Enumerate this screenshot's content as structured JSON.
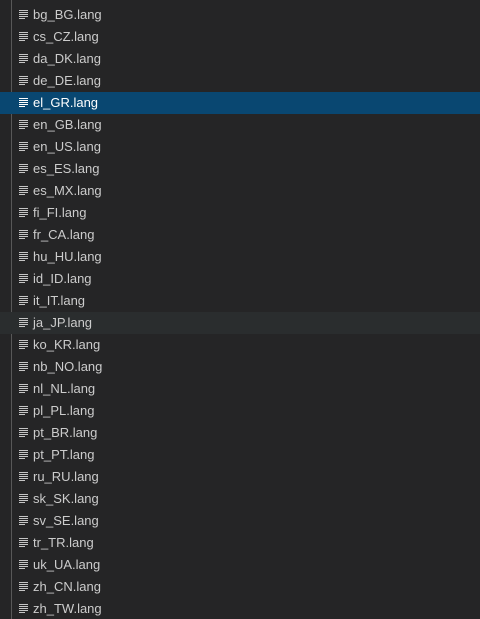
{
  "explorer": {
    "files": [
      {
        "name": "bg_BG.lang",
        "icon": "file-text-icon"
      },
      {
        "name": "cs_CZ.lang",
        "icon": "file-text-icon"
      },
      {
        "name": "da_DK.lang",
        "icon": "file-text-icon"
      },
      {
        "name": "de_DE.lang",
        "icon": "file-text-icon"
      },
      {
        "name": "el_GR.lang",
        "icon": "file-text-icon"
      },
      {
        "name": "en_GB.lang",
        "icon": "file-text-icon"
      },
      {
        "name": "en_US.lang",
        "icon": "file-text-icon"
      },
      {
        "name": "es_ES.lang",
        "icon": "file-text-icon"
      },
      {
        "name": "es_MX.lang",
        "icon": "file-text-icon"
      },
      {
        "name": "fi_FI.lang",
        "icon": "file-text-icon"
      },
      {
        "name": "fr_CA.lang",
        "icon": "file-text-icon"
      },
      {
        "name": "hu_HU.lang",
        "icon": "file-text-icon"
      },
      {
        "name": "id_ID.lang",
        "icon": "file-text-icon"
      },
      {
        "name": "it_IT.lang",
        "icon": "file-text-icon"
      },
      {
        "name": "ja_JP.lang",
        "icon": "file-text-icon"
      },
      {
        "name": "ko_KR.lang",
        "icon": "file-text-icon"
      },
      {
        "name": "nb_NO.lang",
        "icon": "file-text-icon"
      },
      {
        "name": "nl_NL.lang",
        "icon": "file-text-icon"
      },
      {
        "name": "pl_PL.lang",
        "icon": "file-text-icon"
      },
      {
        "name": "pt_BR.lang",
        "icon": "file-text-icon"
      },
      {
        "name": "pt_PT.lang",
        "icon": "file-text-icon"
      },
      {
        "name": "ru_RU.lang",
        "icon": "file-text-icon"
      },
      {
        "name": "sk_SK.lang",
        "icon": "file-text-icon"
      },
      {
        "name": "sv_SE.lang",
        "icon": "file-text-icon"
      },
      {
        "name": "tr_TR.lang",
        "icon": "file-text-icon"
      },
      {
        "name": "uk_UA.lang",
        "icon": "file-text-icon"
      },
      {
        "name": "zh_CN.lang",
        "icon": "file-text-icon"
      },
      {
        "name": "zh_TW.lang",
        "icon": "file-text-icon"
      }
    ],
    "selected": "el_GR.lang",
    "hovered": "ja_JP.lang"
  },
  "colors": {
    "background": "#252526",
    "selected_row": "#094771",
    "hover_row": "#2a2d2e",
    "text": "#cccccc",
    "indent_guide": "#585858"
  }
}
